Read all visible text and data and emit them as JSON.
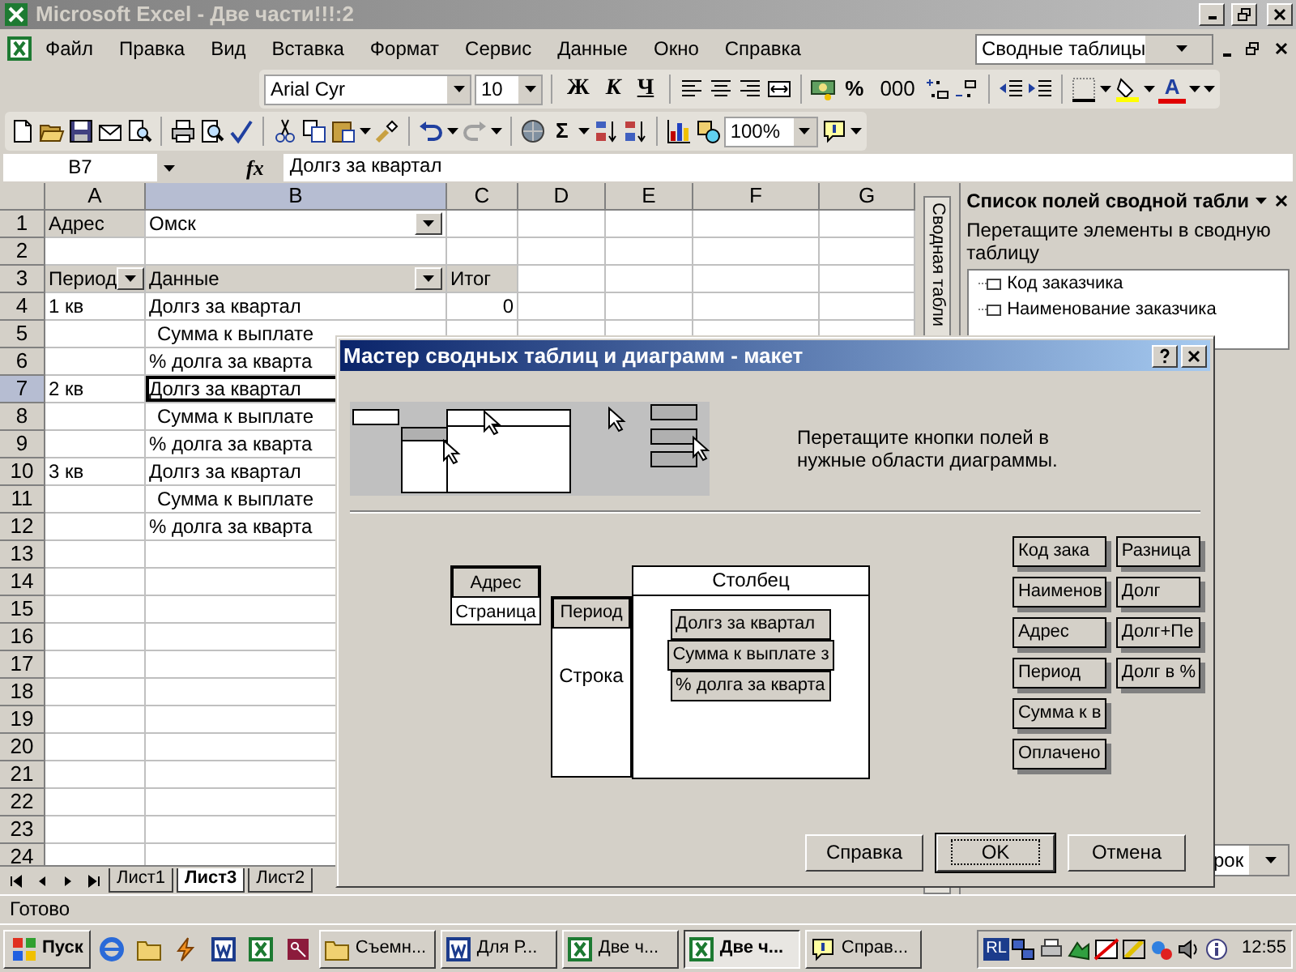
{
  "window": {
    "title": "Microsoft Excel - Две части!!!:2"
  },
  "menu": {
    "items": [
      "Файл",
      "Правка",
      "Вид",
      "Вставка",
      "Формат",
      "Сервис",
      "Данные",
      "Окно",
      "Справка"
    ],
    "help_box": "Сводные таблицы"
  },
  "formatting_toolbar": {
    "font": "Arial Cyr",
    "size": "10",
    "style_buttons": [
      "Ж",
      "К",
      "Ч"
    ],
    "number_buttons": [
      "%",
      "000"
    ],
    "font_color_button": "A"
  },
  "standard_toolbar": {
    "autosum": "Σ",
    "zoom": "100%"
  },
  "formula_bar": {
    "name_box": "B7",
    "fx": "fx",
    "formula": "Долгз за квартал"
  },
  "sheet": {
    "columns": [
      {
        "label": "A",
        "selected": false
      },
      {
        "label": "B",
        "selected": true
      },
      {
        "label": "C",
        "selected": false
      },
      {
        "label": "D",
        "selected": false
      },
      {
        "label": "E",
        "selected": false
      },
      {
        "label": "F",
        "selected": false
      },
      {
        "label": "G",
        "selected": false
      }
    ],
    "rows": [
      {
        "label": "1",
        "selected": false,
        "cells": [
          {
            "kind": "field",
            "text": "Адрес"
          },
          {
            "kind": "select",
            "text": "Омск"
          },
          {
            "kind": "empty"
          }
        ]
      },
      {
        "label": "2",
        "selected": false
      },
      {
        "label": "3",
        "selected": false,
        "cells": [
          {
            "kind": "field-select",
            "text": "Период"
          },
          {
            "kind": "field-select",
            "text": "Данные"
          },
          {
            "kind": "field",
            "text": "Итог"
          }
        ]
      },
      {
        "label": "4",
        "selected": false,
        "cells": [
          {
            "kind": "text",
            "text": "1 кв"
          },
          {
            "kind": "text",
            "text": "Долгз за квартал"
          },
          {
            "kind": "num",
            "text": "0"
          }
        ]
      },
      {
        "label": "5",
        "selected": false,
        "cells": [
          {
            "kind": "empty"
          },
          {
            "kind": "indent",
            "text": "Сумма к выплате"
          }
        ]
      },
      {
        "label": "6",
        "selected": false,
        "cells": [
          {
            "kind": "empty"
          },
          {
            "kind": "text",
            "text": "% долга за кварта"
          }
        ]
      },
      {
        "label": "7",
        "selected": true,
        "cells": [
          {
            "kind": "text",
            "text": "2 кв"
          },
          {
            "kind": "text",
            "text": "Долгз за квартал",
            "active": true
          }
        ]
      },
      {
        "label": "8",
        "selected": false,
        "cells": [
          {
            "kind": "empty"
          },
          {
            "kind": "indent",
            "text": "Сумма к выплате"
          }
        ]
      },
      {
        "label": "9",
        "selected": false,
        "cells": [
          {
            "kind": "empty"
          },
          {
            "kind": "text",
            "text": "% долга за кварта"
          }
        ]
      },
      {
        "label": "10",
        "selected": false,
        "cells": [
          {
            "kind": "text",
            "text": "3 кв"
          },
          {
            "kind": "text",
            "text": "Долгз за квартал"
          }
        ]
      },
      {
        "label": "11",
        "selected": false,
        "cells": [
          {
            "kind": "empty"
          },
          {
            "kind": "indent",
            "text": "Сумма к выплате"
          }
        ]
      },
      {
        "label": "12",
        "selected": false,
        "cells": [
          {
            "kind": "empty"
          },
          {
            "kind": "text",
            "text": "% долга за кварта"
          }
        ]
      },
      {
        "label": "13",
        "selected": false
      },
      {
        "label": "14",
        "selected": false
      },
      {
        "label": "15",
        "selected": false
      },
      {
        "label": "16",
        "selected": false
      },
      {
        "label": "17",
        "selected": false
      },
      {
        "label": "18",
        "selected": false
      },
      {
        "label": "19",
        "selected": false
      },
      {
        "label": "20",
        "selected": false
      },
      {
        "label": "21",
        "selected": false
      },
      {
        "label": "22",
        "selected": false
      },
      {
        "label": "23",
        "selected": false
      },
      {
        "label": "24",
        "selected": false
      }
    ]
  },
  "sheet_tabs": [
    {
      "label": "Лист1",
      "selected": false
    },
    {
      "label": "Лист3",
      "selected": true
    },
    {
      "label": "Лист2",
      "selected": false
    }
  ],
  "status_bar": {
    "text": "Готово"
  },
  "task_pane": {
    "tab": "Сводная табли",
    "title": "Список полей сводной табли",
    "instruction": "Перетащите элементы в сводную таблицу",
    "fields": [
      "Код заказчика",
      "Наименование заказчика"
    ],
    "add_to": "рок"
  },
  "dialog": {
    "title": "Мастер сводных таблиц и диаграмм - макет",
    "hint": "Перетащите кнопки полей в нужные области диаграммы.",
    "page": {
      "label": "Страница",
      "fields": [
        "Адрес"
      ]
    },
    "row": {
      "label": "Строка",
      "fields": [
        "Период"
      ]
    },
    "column": {
      "label": "Столбец"
    },
    "data": {
      "fields": [
        "Долгз за квартал",
        "Сумма к выплате з",
        "% долга за кварта"
      ]
    },
    "field_columns": [
      [
        "Код зака",
        "Наименов",
        "Адрес",
        "Период",
        "Сумма к в",
        "Оплачено"
      ],
      [
        "Разница",
        "Долг",
        "Долг+Пе",
        "Долг в %"
      ]
    ],
    "buttons": [
      {
        "label": "Справка",
        "default": false
      },
      {
        "label": "OK",
        "default": true
      },
      {
        "label": "Отмена",
        "default": false
      }
    ]
  },
  "taskbar": {
    "start": "Пуск",
    "tasks": [
      {
        "label": "Съемн...",
        "selected": false
      },
      {
        "label": "Для Р...",
        "selected": false
      },
      {
        "label": "Две ч...",
        "selected": false
      },
      {
        "label": "Две ч...",
        "selected": true
      },
      {
        "label": "Справ...",
        "selected": false
      }
    ],
    "language": "RL",
    "clock": "12:55"
  }
}
